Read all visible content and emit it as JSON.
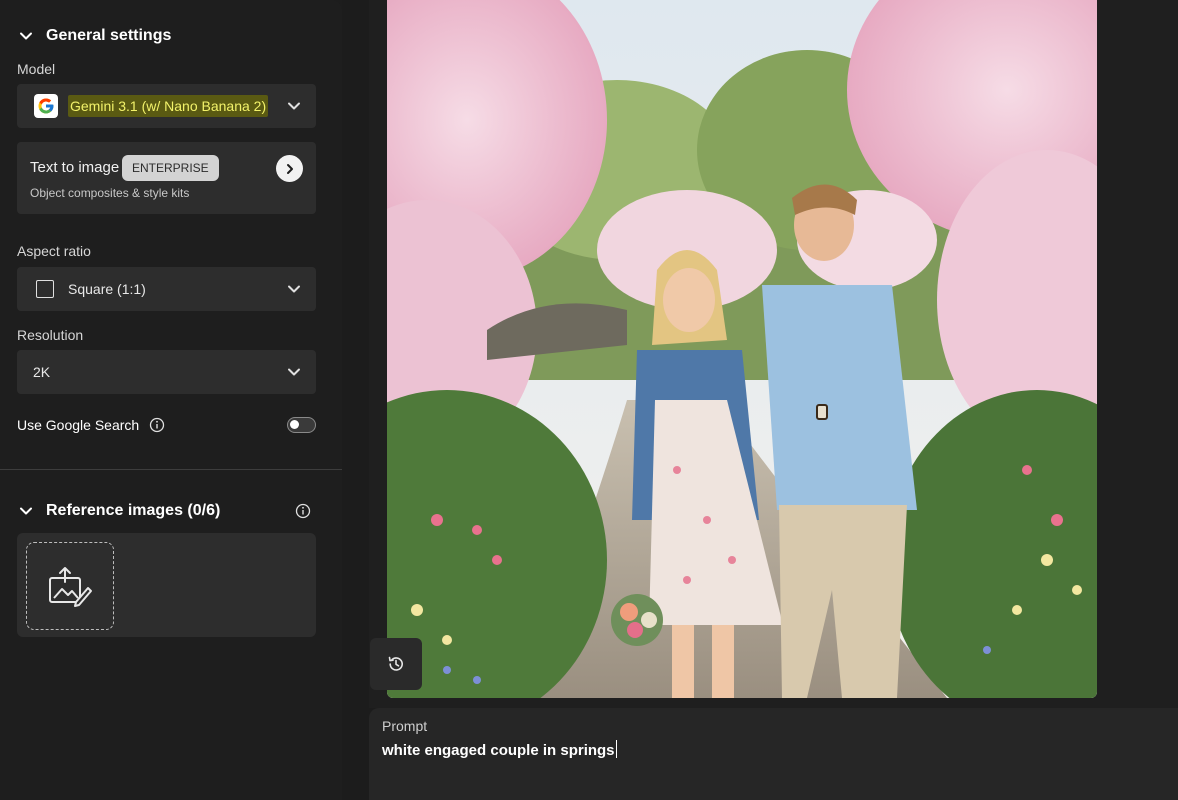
{
  "general": {
    "title": "General settings"
  },
  "model": {
    "label": "Model",
    "value": "Gemini 3.1 (w/ Nano Banana 2)",
    "icon": "google-icon"
  },
  "text_to_image": {
    "title": "Text to image",
    "badge": "ENTERPRISE",
    "subtitle": "Object composites & style kits"
  },
  "aspect_ratio": {
    "label": "Aspect ratio",
    "value": "Square (1:1)"
  },
  "resolution": {
    "label": "Resolution",
    "value": "2K"
  },
  "google_search": {
    "label": "Use Google Search",
    "enabled": false
  },
  "reference_images": {
    "title": "Reference images (0/6)"
  },
  "prompt": {
    "label": "Prompt",
    "value": "white engaged couple in springs"
  },
  "colors": {
    "highlight_bg": "#5a5a12",
    "highlight_text": "#f2f26a",
    "panel": "#2d2d2d",
    "background": "#1d1d1d"
  }
}
